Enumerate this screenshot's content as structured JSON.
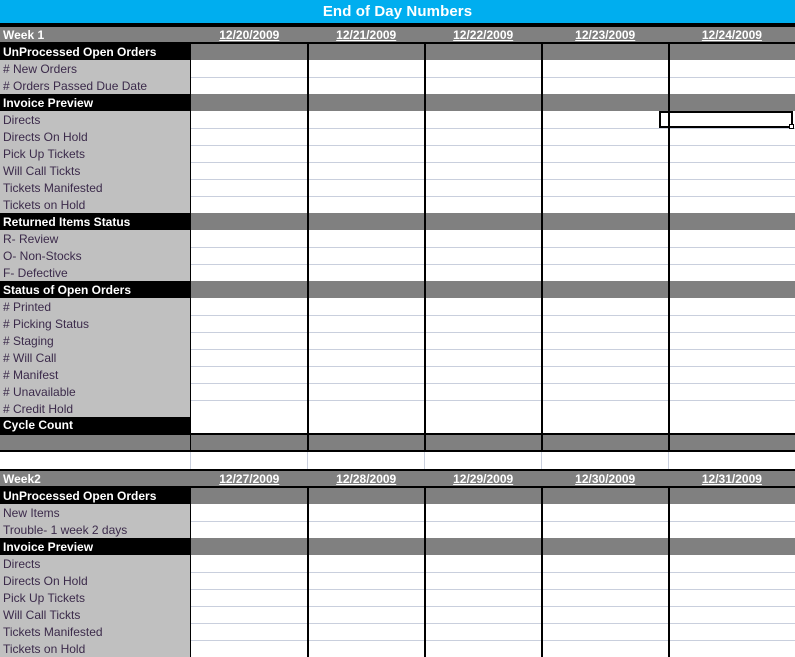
{
  "title": "End of Day Numbers",
  "theme": {
    "title_bar_bg": "#00AEEF",
    "title_text": "#FFFFFF",
    "week_header_bg": "#808080",
    "section_header_bg": "#000000",
    "label_bg": "#C0C0C0",
    "label_text": "#3B2A4A",
    "cell_bg": "#FFFFFF",
    "gridline": "#C9CFDD",
    "border": "#000000"
  },
  "weeks": [
    {
      "name": "Week 1",
      "dates": [
        "12/20/2009",
        "12/21/2009",
        "12/22/2009",
        "12/23/2009",
        "12/24/2009"
      ],
      "sections": [
        {
          "header": "UnProcessed Open Orders",
          "rows": [
            "# New Orders",
            "# Orders Passed Due Date"
          ]
        },
        {
          "header": "Invoice Preview",
          "rows": [
            "Directs",
            "Directs On Hold",
            "Pick Up Tickets",
            "Will Call Tickts",
            "Tickets Manifested",
            "Tickets on Hold"
          ]
        },
        {
          "header": "Returned Items Status",
          "rows": [
            "R- Review",
            "O- Non-Stocks",
            "F- Defective"
          ]
        },
        {
          "header": "Status of Open Orders",
          "rows": [
            "# Printed",
            "# Picking Status",
            "# Staging",
            "# Will Call",
            "# Manifest",
            "# Unavailable",
            "# Credit Hold"
          ]
        }
      ],
      "footer": {
        "header": "Cycle Count",
        "rows": []
      }
    },
    {
      "name": "Week2",
      "dates": [
        "12/27/2009",
        "12/28/2009",
        "12/29/2009",
        "12/30/2009",
        "12/31/2009"
      ],
      "sections": [
        {
          "header": "UnProcessed Open Orders",
          "rows": [
            "New Items",
            "Trouble- 1 week 2 days"
          ]
        },
        {
          "header": "Invoice Preview",
          "rows": [
            "Directs",
            "Directs On Hold",
            "Pick Up Tickets",
            "Will Call Tickts",
            "Tickets Manifested",
            "Tickets on Hold"
          ]
        }
      ],
      "footer": null
    }
  ],
  "selection": {
    "column": "12/24/2009",
    "row": "Directs",
    "value": ""
  }
}
